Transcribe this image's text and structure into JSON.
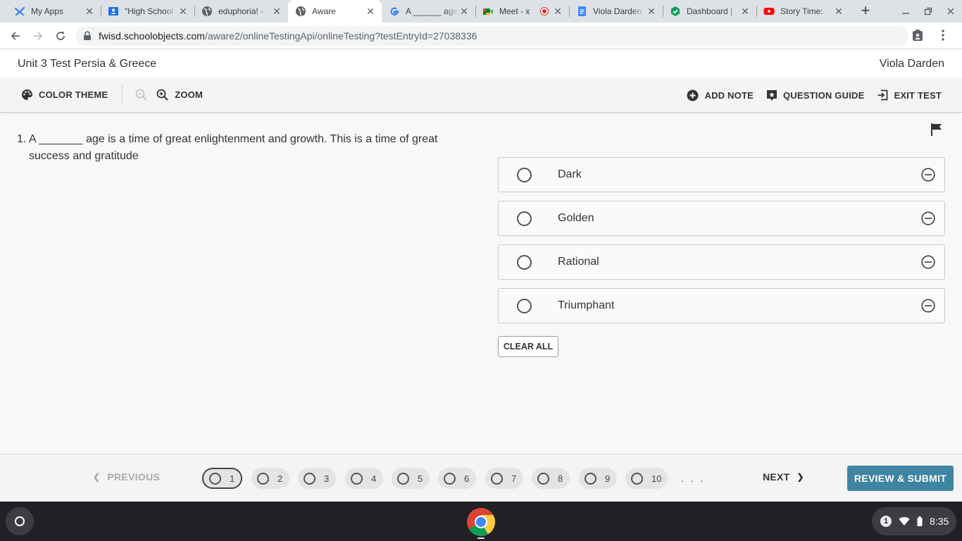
{
  "browser": {
    "tabs": [
      {
        "title": "My Apps",
        "icon": "my-apps-icon"
      },
      {
        "title": "\"High School",
        "icon": "classroom-icon"
      },
      {
        "title": "eduphoria! -",
        "icon": "globe-icon"
      },
      {
        "title": "Aware",
        "icon": "globe-icon",
        "active": true
      },
      {
        "title": "A ______ age",
        "icon": "google-icon"
      },
      {
        "title": "Meet - x",
        "icon": "meet-icon",
        "recording": true
      },
      {
        "title": "Viola Darden",
        "icon": "docs-icon"
      },
      {
        "title": "Dashboard |",
        "icon": "dashboard-icon"
      },
      {
        "title": "Story Time:",
        "icon": "youtube-icon"
      }
    ],
    "url_host": "fwisd.schoolobjects.com",
    "url_path": "/aware2/onlineTestingApi/onlineTesting?testEntryId=27038336"
  },
  "app": {
    "test_title": "Unit 3 Test Persia & Greece",
    "user_name": "Viola Darden"
  },
  "toolbar": {
    "color_theme": "COLOR THEME",
    "zoom": "ZOOM",
    "add_note": "ADD NOTE",
    "question_guide": "QUESTION GUIDE",
    "exit_test": "EXIT TEST"
  },
  "question": {
    "number": "1.",
    "text": "A _______ age is a time of great enlightenment and growth. This is a time of great success and gratitude"
  },
  "answers": [
    "Dark",
    "Golden",
    "Rational",
    "Triumphant"
  ],
  "clear_all": "CLEAR ALL",
  "navigation": {
    "previous": "PREVIOUS",
    "next": "NEXT",
    "pages": [
      "1",
      "2",
      "3",
      "4",
      "5",
      "6",
      "7",
      "8",
      "9",
      "10"
    ],
    "current_page": "1",
    "more": ". . .",
    "review_submit": "REVIEW & SUBMIT"
  },
  "shelf": {
    "notification_count": "1",
    "time": "8:35"
  },
  "colors": {
    "review_button": "#3f84a0",
    "shelf": "#202124",
    "tab_strip": "#dee1e6"
  }
}
